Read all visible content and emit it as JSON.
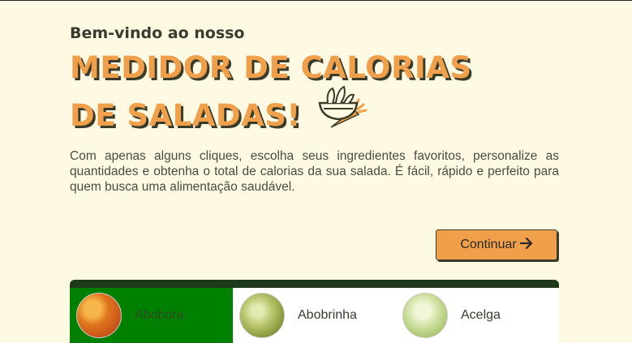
{
  "hero": {
    "welcome": "Bem-vindo ao nosso",
    "title": "MEDIDOR DE CALORIAS DE SALADAS!",
    "icon": "salad-bowl-icon",
    "description": "Com apenas alguns cliques, escolha seus ingredientes favoritos, personalize as quantidades e obtenha o total de calorias da sua salada. É fácil, rápido e perfeito para quem busca uma alimentação saudável."
  },
  "continue_button": {
    "label": "Continuar",
    "icon": "arrow-right-icon"
  },
  "ingredients": [
    {
      "name": "Abobora",
      "selected": true
    },
    {
      "name": "Abobrinha",
      "selected": false
    },
    {
      "name": "Acelga",
      "selected": false
    }
  ],
  "colors": {
    "background": "#fdf9e3",
    "accent": "#f0a04b",
    "dark": "#3b3b2a",
    "selected_card": "#008000",
    "grid_header": "#1f3a1a"
  }
}
